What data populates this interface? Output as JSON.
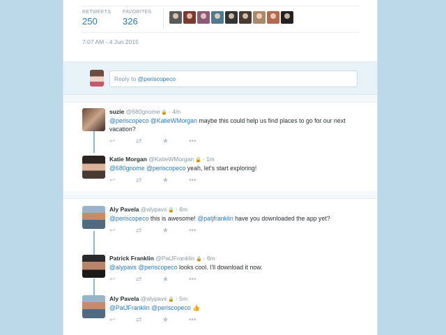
{
  "stats": {
    "retweets_label": "RETWEETS",
    "retweets_value": "250",
    "favorites_label": "FAVORITES",
    "favorites_value": "326",
    "favoriter_colors": [
      "#5a5a5a",
      "#7a3b2e",
      "#8a5a7a",
      "#4f7a8e",
      "#333333",
      "#4a3a30",
      "#a88a6a",
      "#b06a50",
      "#222222"
    ],
    "timestamp": "7:07 AM - 4 Jun 2015"
  },
  "reply": {
    "prefix": "Reply to ",
    "mention": "@periscopeco"
  },
  "conversations": [
    {
      "tweets": [
        {
          "name": "suzie",
          "handle": "@680gnome",
          "time": "· 4m",
          "segments": [
            {
              "t": "@periscopeco",
              "m": true
            },
            {
              "t": " ",
              "m": false
            },
            {
              "t": "@KatieWMorgan",
              "m": true
            },
            {
              "t": " maybe this could help us find places to go for our next vacation?",
              "m": false
            }
          ]
        },
        {
          "name": "Katie Morgan",
          "handle": "@KatieWMorgan",
          "time": "· 1m",
          "segments": [
            {
              "t": "@680gnome",
              "m": true
            },
            {
              "t": " ",
              "m": false
            },
            {
              "t": "@periscopeco",
              "m": true
            },
            {
              "t": " yeah, let's start exploring!",
              "m": false
            }
          ]
        }
      ]
    },
    {
      "tweets": [
        {
          "name": "Aly Pavela",
          "handle": "@alypavs",
          "time": "· 6m",
          "segments": [
            {
              "t": "@periscopeco",
              "m": true
            },
            {
              "t": " this is awesome! ",
              "m": false
            },
            {
              "t": "@patjfranklin",
              "m": true
            },
            {
              "t": " have you downloaded the app yet?",
              "m": false
            }
          ]
        },
        {
          "name": "Patrick Franklin",
          "handle": "@PatJFranklin",
          "time": "· 6m",
          "segments": [
            {
              "t": "@alypavs",
              "m": true
            },
            {
              "t": " ",
              "m": false
            },
            {
              "t": "@periscopeco",
              "m": true
            },
            {
              "t": " looks cool. I'll download it now.",
              "m": false
            }
          ]
        },
        {
          "name": "Aly Pavela",
          "handle": "@alypavs",
          "time": "· 5m",
          "segments": [
            {
              "t": "@PatJFranklin",
              "m": true
            },
            {
              "t": " ",
              "m": false
            },
            {
              "t": "@periscopeco",
              "m": true
            },
            {
              "t": " ",
              "m": false
            },
            {
              "t": "👍",
              "m": false,
              "emoji": true
            }
          ]
        }
      ]
    }
  ],
  "actions": {
    "reply": "↩",
    "retweet": "⇄",
    "favorite": "★",
    "more": "•••"
  }
}
